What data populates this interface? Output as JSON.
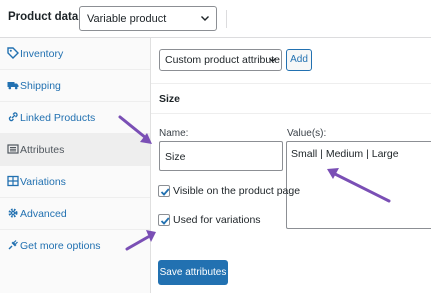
{
  "header": {
    "title": "Product data —",
    "product_type": "Variable product"
  },
  "sidebar": {
    "items": [
      {
        "label": "Inventory",
        "icon": "tag-icon"
      },
      {
        "label": "Shipping",
        "icon": "truck-icon"
      },
      {
        "label": "Linked Products",
        "icon": "link-icon"
      },
      {
        "label": "Attributes",
        "icon": "list-icon",
        "active": true
      },
      {
        "label": "Variations",
        "icon": "grid-icon"
      },
      {
        "label": "Advanced",
        "icon": "gear-icon"
      },
      {
        "label": "Get more options",
        "icon": "plugin-icon"
      }
    ]
  },
  "toolbar": {
    "attribute_select": "Custom product attribute",
    "add_label": "Add"
  },
  "attribute": {
    "title": "Size",
    "name_label": "Name:",
    "name_value": "Size",
    "values_label": "Value(s):",
    "values_value": "Small | Medium | Large",
    "visible_label": "Visible on the product page",
    "visible_checked": true,
    "variations_label": "Used for variations",
    "variations_checked": true
  },
  "save_label": "Save attributes",
  "colors": {
    "accent": "#2271b1",
    "annotation_arrow": "#7a4fb5"
  }
}
